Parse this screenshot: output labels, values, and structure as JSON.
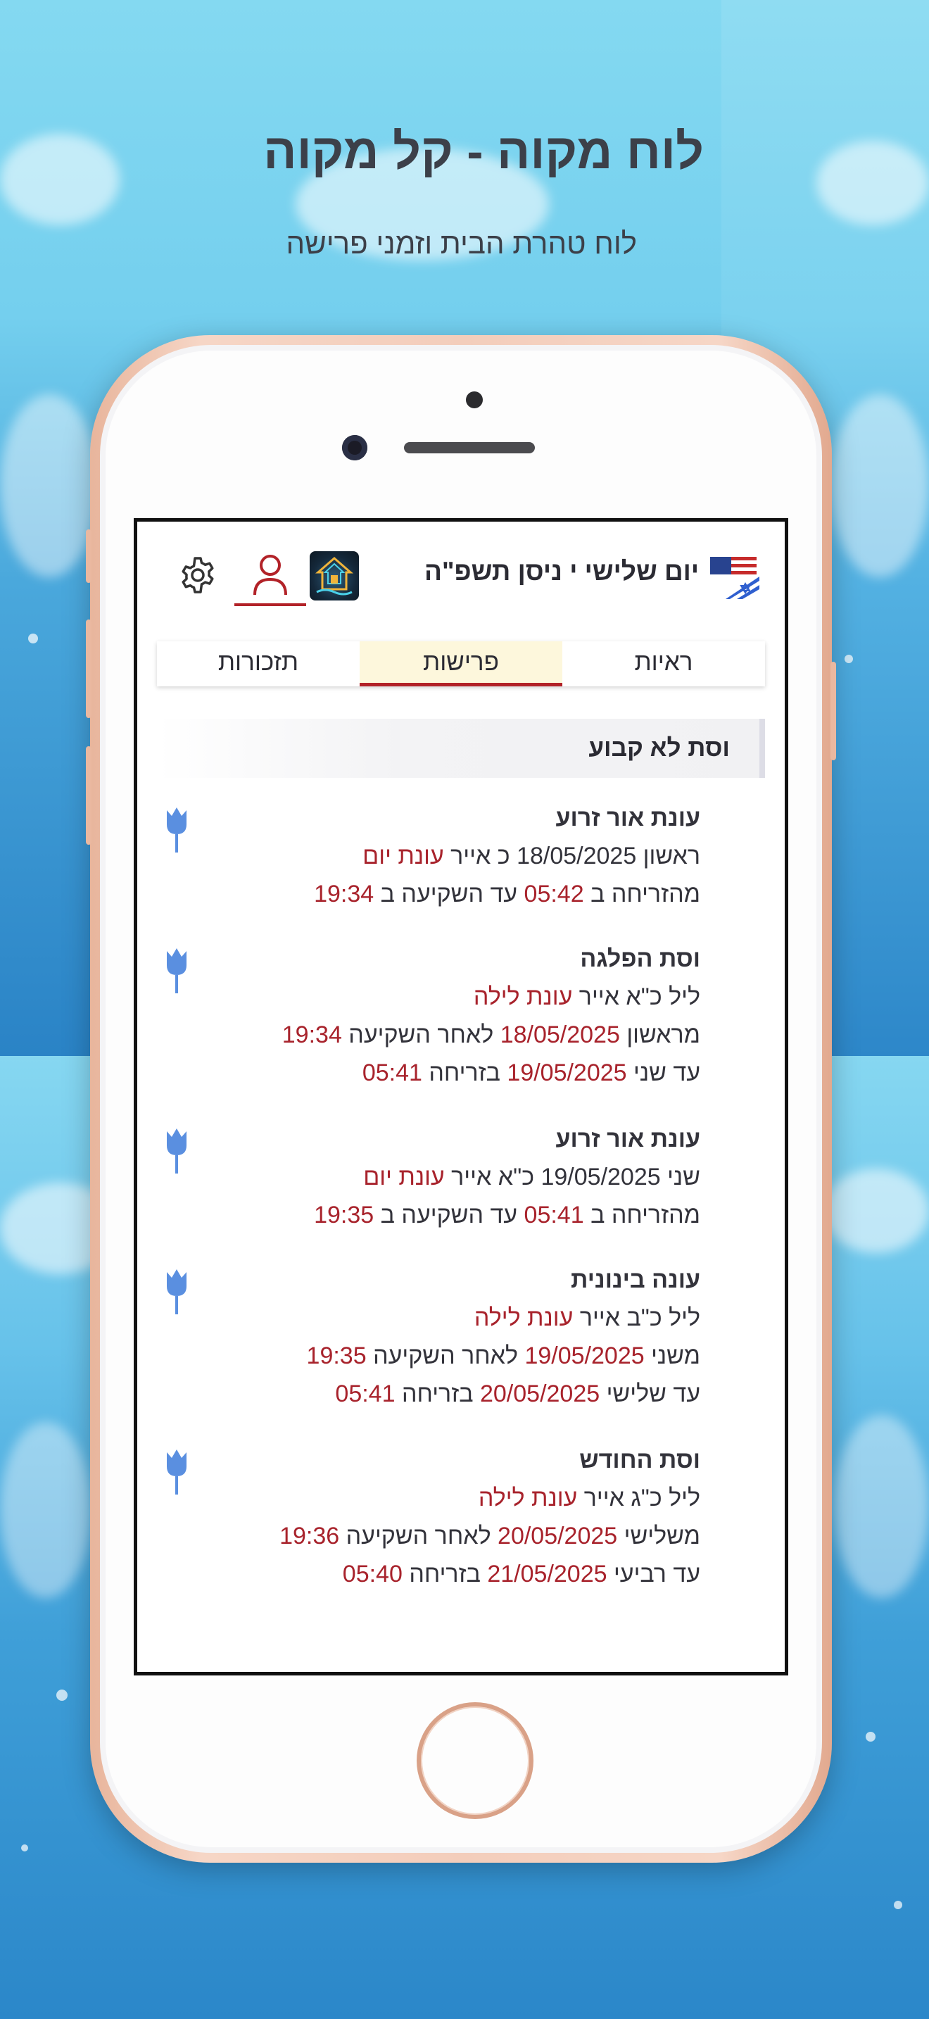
{
  "promo": {
    "headline": "לוח מקוה - קל מקוה",
    "subheadline": "לוח טהרת הבית וזמני פרישה"
  },
  "colors": {
    "accent": "#b22228",
    "date_highlight": "#a8232c",
    "active_tab_bg": "#fdf7dc",
    "rose_icon": "#5a8fe0"
  },
  "header": {
    "date_title": "יום שלישי י ניסן תשפ\"ה",
    "flag_icon": "us-israel-flag-icon",
    "app_icon": "mikveh-app-icon",
    "user_icon": "user-icon",
    "settings_icon": "gear-icon"
  },
  "tabs": [
    {
      "label": "ראיות",
      "active": false
    },
    {
      "label": "פרישות",
      "active": true
    },
    {
      "label": "תזכורות",
      "active": false
    }
  ],
  "section": {
    "title": "וסת לא קבוע"
  },
  "entries": [
    {
      "title": "עונת אור זרוע",
      "l1_plain": "ראשון 18/05/2025 כ אייר ",
      "l1_red": "עונת יום",
      "l2_plain_a": "מהזריחה ב ",
      "l2_red_a": "05:42",
      "l2_plain_b": " עד השקיעה ב ",
      "l2_red_b": "19:34"
    },
    {
      "title": "וסת הפלגה",
      "l1_plain": "ליל כ\"א אייר ",
      "l1_red": "עונת לילה",
      "l2_plain_a": "מראשון ",
      "l2_red_a": "18/05/2025",
      "l2_plain_b": " לאחר השקיעה ",
      "l2_red_b": "19:34",
      "l3_plain_a": "עד שני ",
      "l3_red_a": "19/05/2025",
      "l3_plain_b": " בזריחה ",
      "l3_red_b": "05:41"
    },
    {
      "title": "עונת אור זרוע",
      "l1_plain": "שני 19/05/2025 כ\"א אייר ",
      "l1_red": "עונת יום",
      "l2_plain_a": "מהזריחה ב ",
      "l2_red_a": "05:41",
      "l2_plain_b": " עד השקיעה ב ",
      "l2_red_b": "19:35"
    },
    {
      "title": "עונה בינונית",
      "l1_plain": "ליל כ\"ב אייר ",
      "l1_red": "עונת לילה",
      "l2_plain_a": "משני ",
      "l2_red_a": "19/05/2025",
      "l2_plain_b": " לאחר השקיעה ",
      "l2_red_b": "19:35",
      "l3_plain_a": "עד שלישי ",
      "l3_red_a": "20/05/2025",
      "l3_plain_b": " בזריחה ",
      "l3_red_b": "05:41"
    },
    {
      "title": "וסת החודש",
      "l1_plain": "ליל כ\"ג אייר ",
      "l1_red": "עונת לילה",
      "l2_plain_a": "משלישי ",
      "l2_red_a": "20/05/2025",
      "l2_plain_b": " לאחר השקיעה ",
      "l2_red_b": "19:36",
      "l3_plain_a": "עד רביעי ",
      "l3_red_a": "21/05/2025",
      "l3_plain_b": " בזריחה ",
      "l3_red_b": "05:40"
    }
  ]
}
